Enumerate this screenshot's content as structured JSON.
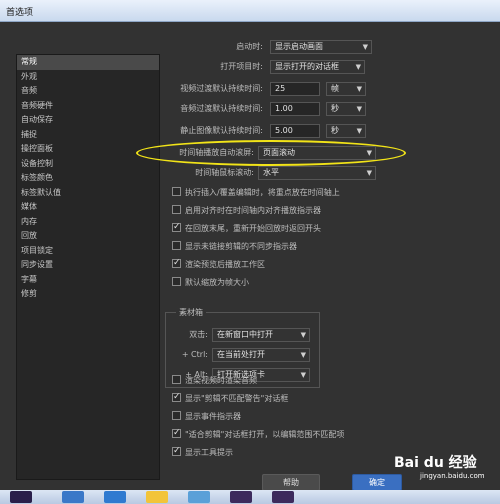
{
  "window": {
    "title": "首选项"
  },
  "sidebar": {
    "items": [
      {
        "label": "常规",
        "active": true
      },
      {
        "label": "外观"
      },
      {
        "label": "音频"
      },
      {
        "label": "音频硬件"
      },
      {
        "label": "自动保存"
      },
      {
        "label": "捕捉"
      },
      {
        "label": "操控面板"
      },
      {
        "label": "设备控制"
      },
      {
        "label": "标签颜色"
      },
      {
        "label": "标签默认值"
      },
      {
        "label": "媒体"
      },
      {
        "label": "内存"
      },
      {
        "label": "回放"
      },
      {
        "label": "项目锁定"
      },
      {
        "label": "同步设置"
      },
      {
        "label": "字幕"
      },
      {
        "label": "修剪"
      }
    ]
  },
  "general": {
    "startup": {
      "label": "启动时:",
      "value": "显示启动画面"
    },
    "open_project": {
      "label": "打开项目时:",
      "value": "显示打开的对话框"
    },
    "video_transition": {
      "label": "视频过渡默认持续时间:",
      "value": "25",
      "unit": "帧"
    },
    "audio_transition": {
      "label": "音频过渡默认持续时间:",
      "value": "1.00",
      "unit": "秒"
    },
    "still_image": {
      "label": "静止图像默认持续时间:",
      "value": "5.00",
      "unit": "秒"
    },
    "timeline_scroll": {
      "label": "时间轴播放自动滚屏:",
      "value": "页面滚动"
    },
    "timeline_mouse": {
      "label": "时间轴鼠标滚动:",
      "value": "水平"
    },
    "checkboxes_a": [
      {
        "label": "执行插入/覆盖编辑时，将重点放在时间轴上",
        "checked": false
      },
      {
        "label": "启用对齐时在时间轴内对齐播放指示器",
        "checked": false
      },
      {
        "label": "在回放末尾，重新开始回放时返回开头",
        "checked": true
      },
      {
        "label": "显示未链接剪辑的不同步指示器",
        "checked": false
      },
      {
        "label": "渲染预览后播放工作区",
        "checked": true
      },
      {
        "label": "默认缩放为帧大小",
        "checked": false
      }
    ],
    "bins": {
      "title": "素材箱",
      "double_click": {
        "label": "双击:",
        "value": "在新窗口中打开"
      },
      "ctrl": {
        "label": "+ Ctrl:",
        "value": "在当前处打开"
      },
      "alt": {
        "label": "+ Alt:",
        "value": "打开新选项卡"
      }
    },
    "checkboxes_b": [
      {
        "label": "渲染视频时渲染音频",
        "checked": false
      },
      {
        "label": "显示\"剪辑不匹配警告\"对话框",
        "checked": true
      },
      {
        "label": "显示事件指示器",
        "checked": false
      },
      {
        "label": "\"适合剪辑\"对话框打开，以编辑范围不匹配项",
        "checked": true
      },
      {
        "label": "显示工具提示",
        "checked": true
      }
    ]
  },
  "footer": {
    "help": "帮助",
    "ok": "确定"
  },
  "watermark": {
    "text": "Bai du 经验",
    "sub": "jingyan.baidu.com"
  },
  "colors": {
    "highlight_ellipse": "#f2e418",
    "primary_button": "#3a6fc1"
  }
}
